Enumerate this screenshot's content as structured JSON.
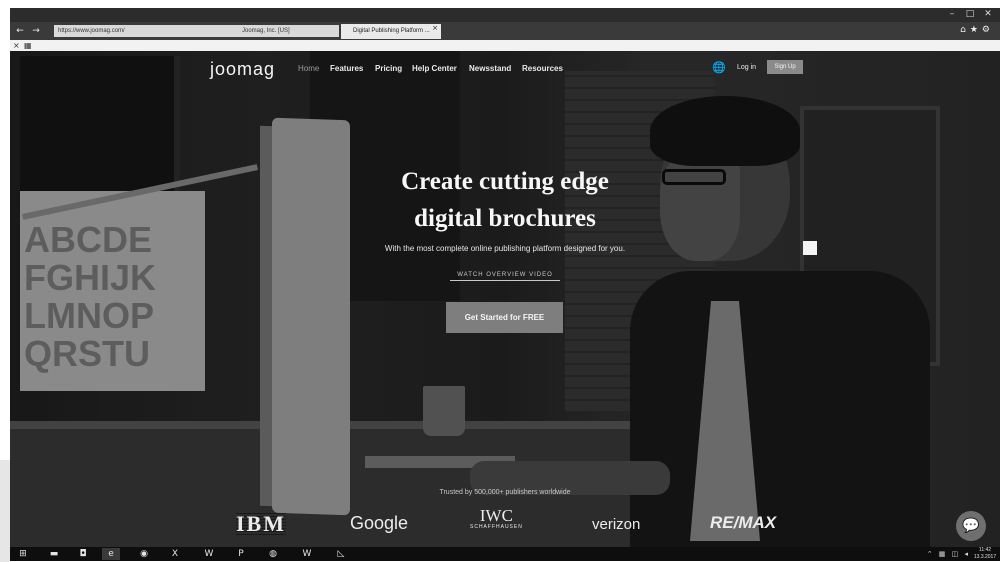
{
  "browser": {
    "window_controls": [
      "–",
      "□",
      "✕"
    ],
    "nav_back": "←",
    "nav_forward": "→",
    "address": "https://www.joomag.com/",
    "address_tools": "Joomag, Inc. [US] ",
    "tab_title": "Digital Publishing Platform ...",
    "tab_close": "×",
    "right_icons": "⌂★⚙",
    "fav_close": "×",
    "fav_icon": "▦"
  },
  "site": {
    "logo": "joomag",
    "nav": {
      "home": "Home",
      "features": "Features",
      "pricing": "Pricing",
      "help": "Help Center",
      "newsstand": "Newsstand",
      "resources": "Resources"
    },
    "globe": "🌐",
    "login": "Log in",
    "signup": "Sign Up"
  },
  "hero": {
    "title_line1": "Create cutting edge",
    "title_line2": "digital brochures",
    "subtitle": "With the most complete online publishing platform designed for you.",
    "watch_video": "WATCH OVERVIEW VIDEO",
    "cta": "Get Started for FREE"
  },
  "trust": {
    "text": "Trusted by 500,000+ publishers worldwide",
    "logos": {
      "ibm": "IBM",
      "google": "Google",
      "iwc": "IWC",
      "iwc_sub": "SCHAFFHAUSEN",
      "verizon": "verizon",
      "remax": "RE/MAX"
    }
  },
  "poster_letters": "ABCDE\nFGHIJK\nLMNOP\nQRSTU",
  "chat_icon": "💬",
  "taskbar": {
    "start": "⊞",
    "file_explorer": "▬",
    "store": "◘",
    "edge": "e",
    "chrome": "◉",
    "excel": "X",
    "word": "W",
    "powerpoint": "P",
    "firefox": "◍",
    "app_w": "W",
    "app_chart": "◺",
    "tray": "⌃ ▦ ◫ ◂",
    "time": "11:42",
    "date": "13.3.2017"
  }
}
